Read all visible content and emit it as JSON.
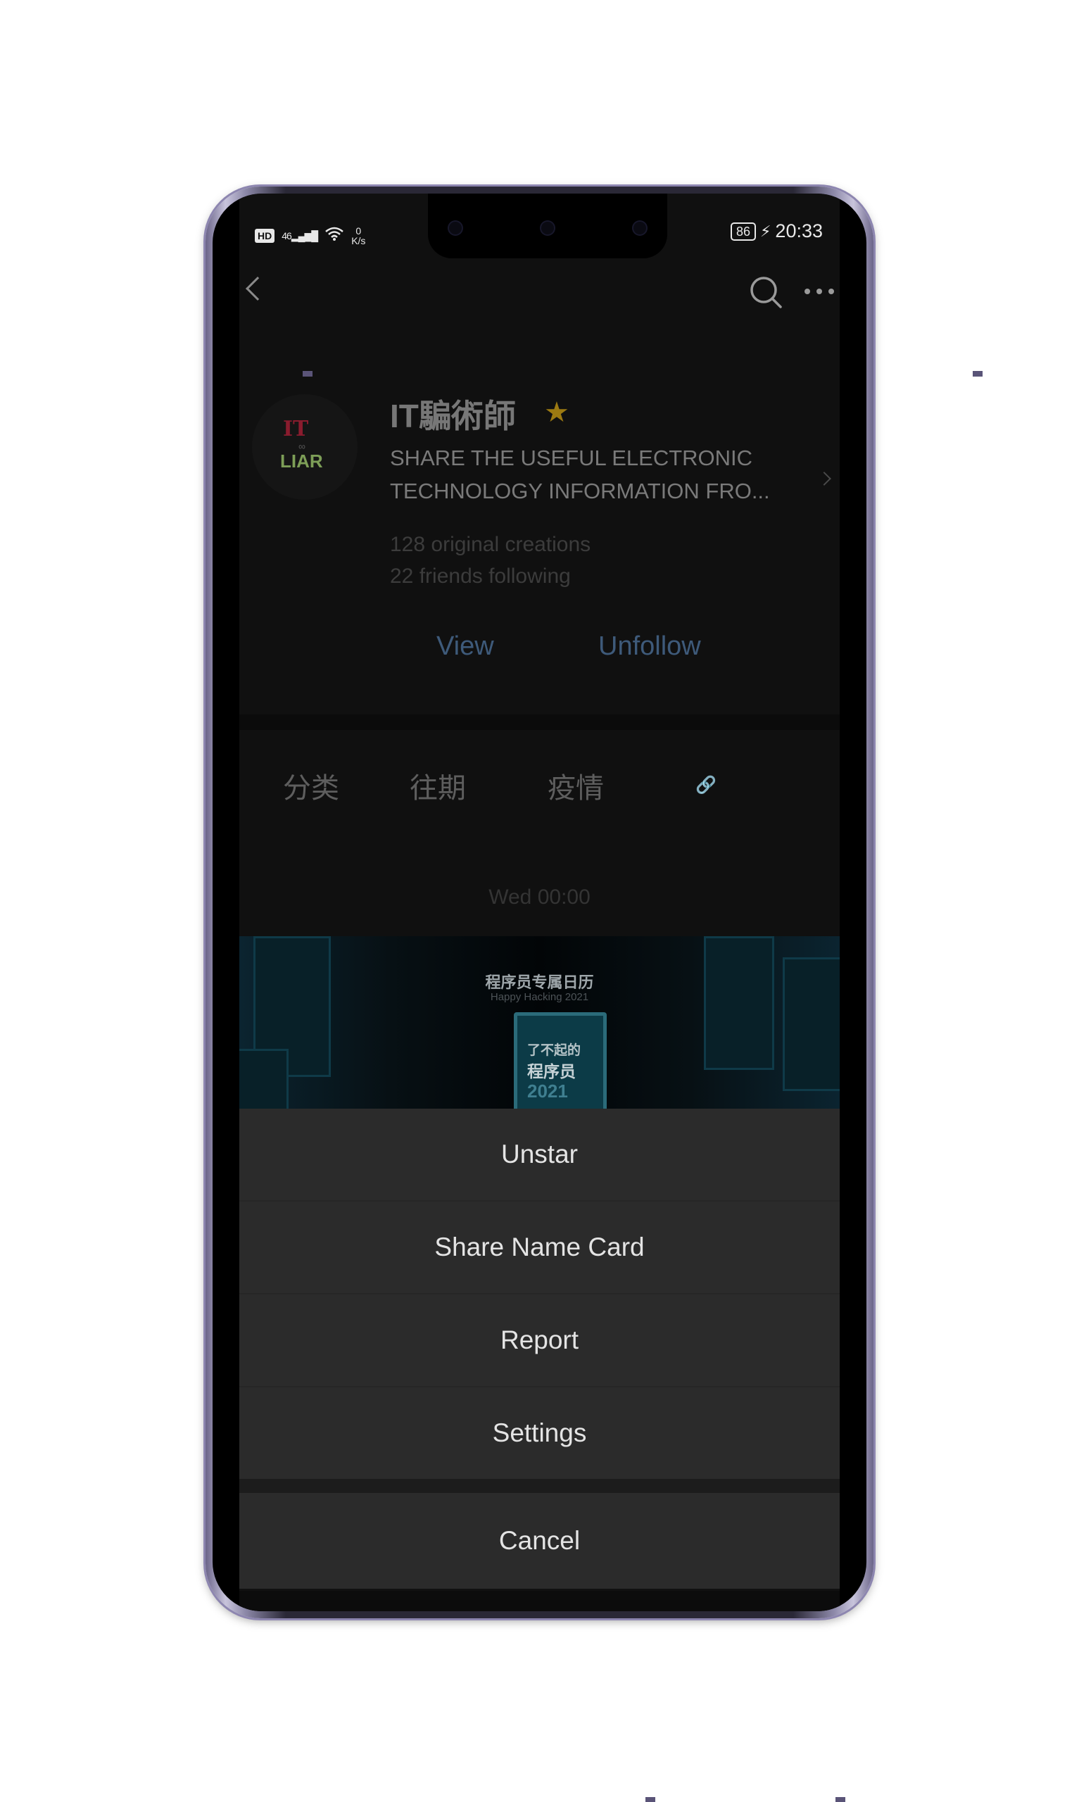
{
  "status_bar": {
    "hd": "HD",
    "signal": "46",
    "net_speed_value": "0",
    "net_speed_unit": "K/s",
    "battery": "86",
    "time": "20:33"
  },
  "app_bar": {
    "back_icon": "chevron-left-icon",
    "search_icon": "search-icon",
    "more_icon": "more-dots-icon"
  },
  "profile": {
    "avatar_line1": "IT",
    "avatar_line2": "∞",
    "avatar_line3": "LIAR",
    "name": "IT騙術師",
    "star_icon": "★",
    "description": "SHARE THE USEFUL ELECTRONIC TECHNOLOGY INFORMATION FRO...",
    "original_creations": "128 original creations",
    "friends_following": "22 friends following",
    "view_label": "View",
    "unfollow_label": "Unfollow"
  },
  "menu_tabs": [
    {
      "label": "分类"
    },
    {
      "label": "往期"
    },
    {
      "label": "疫情"
    }
  ],
  "feed": {
    "date": "Wed 00:00",
    "cover_title": "程序员专属日历",
    "cover_subtitle": "Happy Hacking 2021",
    "book_line1": "了不起的",
    "book_line2": "程序员",
    "book_line3": "2021"
  },
  "action_sheet": {
    "items": [
      {
        "label": "Unstar"
      },
      {
        "label": "Share Name Card"
      },
      {
        "label": "Report"
      },
      {
        "label": "Settings"
      }
    ],
    "cancel_label": "Cancel"
  },
  "colors": {
    "sheet_bg": "#2b2b2b",
    "accent_link": "#3e5a7a",
    "phone_frame": "#8d86b0"
  }
}
